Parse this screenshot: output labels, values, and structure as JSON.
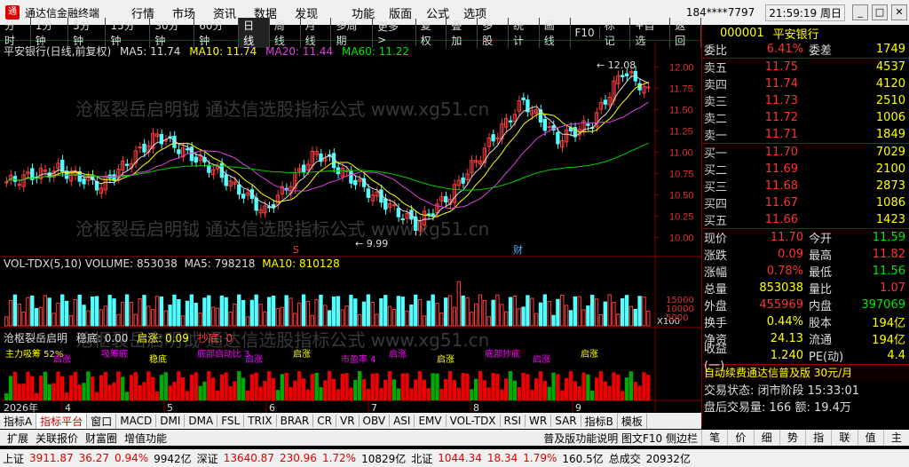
{
  "app": {
    "title": "通达信金融终端",
    "account": "184****7797",
    "clock": "21:59:19 周日"
  },
  "menu": [
    "行情",
    "市场",
    "资讯",
    "数据",
    "发现"
  ],
  "menu2": [
    "功能",
    "版面",
    "公式",
    "选项"
  ],
  "toolbar": [
    "分时",
    "1分钟",
    "5分钟",
    "15分钟",
    "30分钟",
    "60分钟",
    "日线",
    "周线",
    "月线",
    "多周期",
    "更多 >",
    "复权",
    "叠加",
    "多股",
    "统计",
    "画线",
    "F10",
    "标记",
    "+自选",
    "返回"
  ],
  "toolbar_active": "日线",
  "main_legend": {
    "prefix": "平安银行(日线,前复权)",
    "ma5": "MA5: 11.74",
    "ma10": "MA10: 11.74",
    "ma20": "MA20: 11.44",
    "ma60": "MA60: 11.22"
  },
  "vol_legend": {
    "label": "VOL-TDX(5,10) VOLUME: 853038",
    "ma5": "MA5: 798218",
    "ma10": "MA10: 810128"
  },
  "ind_legend": {
    "label": "沧枢裂岳启明",
    "stable": "稳底: 0.00",
    "start": "启涨: 0.09",
    "bottom": "抄底: 0"
  },
  "chart_labels": {
    "high": "12.08",
    "low": "9.99",
    "s_mark": "S",
    "cai_mark": "财",
    "vol_axis": "X100",
    "date_year": "2026年",
    "months": [
      "4",
      "5",
      "6",
      "7",
      "8",
      "9"
    ]
  },
  "price_axis": [
    "12.00",
    "11.75",
    "11.50",
    "11.25",
    "11.00",
    "10.75",
    "10.50",
    "10.25",
    "10.00"
  ],
  "vol_axis_ticks": [
    "15000",
    "10000",
    "5000"
  ],
  "ind_annotations": [
    "主力吸筹 52%",
    "启涨",
    "吸筹底",
    "稳底",
    "底部启动比 3",
    "启涨",
    "启涨",
    "市盈率 4",
    "启涨",
    "启涨",
    "底部抄底",
    "启涨",
    "启涨"
  ],
  "watermark": "沧枢裂岳启明钺 通达信选股指标公式 www.xg51.cn",
  "quote": {
    "code": "000001",
    "name": "平安银行",
    "ratio_label": "委比",
    "ratio": "6.41%",
    "diff_label": "委差",
    "diff": "1749",
    "asks": [
      {
        "label": "卖五",
        "price": "11.75",
        "vol": "4537"
      },
      {
        "label": "卖四",
        "price": "11.74",
        "vol": "4120"
      },
      {
        "label": "卖三",
        "price": "11.73",
        "vol": "2510"
      },
      {
        "label": "卖二",
        "price": "11.72",
        "vol": "1006"
      },
      {
        "label": "卖一",
        "price": "11.71",
        "vol": "1849"
      }
    ],
    "bids": [
      {
        "label": "买一",
        "price": "11.70",
        "vol": "7029"
      },
      {
        "label": "买二",
        "price": "11.69",
        "vol": "2100"
      },
      {
        "label": "买三",
        "price": "11.68",
        "vol": "2873"
      },
      {
        "label": "买四",
        "price": "11.67",
        "vol": "1086"
      },
      {
        "label": "买五",
        "price": "11.66",
        "vol": "1423"
      }
    ],
    "stats": [
      {
        "l1": "现价",
        "v1": "11.70",
        "c1": "red",
        "l2": "今开",
        "v2": "11.59",
        "c2": "grn"
      },
      {
        "l1": "涨跌",
        "v1": "0.09",
        "c1": "red",
        "l2": "最高",
        "v2": "11.82",
        "c2": "red"
      },
      {
        "l1": "涨幅",
        "v1": "0.78%",
        "c1": "red",
        "l2": "最低",
        "v2": "11.56",
        "c2": "grn"
      },
      {
        "l1": "总量",
        "v1": "853038",
        "c1": "yel",
        "l2": "量比",
        "v2": "1.07",
        "c2": "red"
      },
      {
        "l1": "外盘",
        "v1": "455969",
        "c1": "red",
        "l2": "内盘",
        "v2": "397069",
        "c2": "grn"
      },
      {
        "l1": "换手",
        "v1": "0.44%",
        "c1": "yel",
        "l2": "股本",
        "v2": "194亿",
        "c2": "yel"
      },
      {
        "l1": "净资",
        "v1": "24.13",
        "c1": "yel",
        "l2": "流通",
        "v2": "194亿",
        "c2": "yel"
      },
      {
        "l1": "收益(一)",
        "v1": "1.240",
        "c1": "yel",
        "l2": "PE(动)",
        "v2": "4.4",
        "c2": "yel"
      }
    ],
    "ad": "自动续费通达信普及版 30元/月",
    "trade_state": "交易状态: 闭市阶段  15:33:01",
    "last_deal": "盘后交易量: 166  额: 19.4万"
  },
  "bottom_tabs": [
    "指标A",
    "指标平台",
    "窗口",
    "MACD",
    "DMI",
    "DMA",
    "FSL",
    "TRIX",
    "BRAR",
    "CR",
    "VR",
    "OBV",
    "ASI",
    "EMV",
    "VOL-TDX",
    "RSI",
    "WR",
    "SAR",
    "指标B",
    "模板"
  ],
  "bottom_tabs_active": "指标平台",
  "bottom_tabs2": [
    "扩展",
    "关联报价",
    "财富圈",
    "增值功能"
  ],
  "bottom_tabs2_right": "普及版功能说明  图文F10 侧边栏",
  "trade_tabs": [
    "笔",
    "价",
    "细",
    "势",
    "指",
    "联",
    "值",
    "主"
  ],
  "status": [
    {
      "t": "上证",
      "c": "blk"
    },
    {
      "t": "3911.87",
      "c": "red"
    },
    {
      "t": "36.27",
      "c": "red"
    },
    {
      "t": "0.94%",
      "c": "red"
    },
    {
      "t": "9942亿",
      "c": "blk"
    },
    {
      "t": "深证",
      "c": "blk"
    },
    {
      "t": "13640.87",
      "c": "red"
    },
    {
      "t": "230.96",
      "c": "red"
    },
    {
      "t": "1.72%",
      "c": "red"
    },
    {
      "t": "10829亿",
      "c": "blk"
    },
    {
      "t": "北证",
      "c": "blk"
    },
    {
      "t": "1044.34",
      "c": "red"
    },
    {
      "t": "18.34",
      "c": "red"
    },
    {
      "t": "1.79%",
      "c": "red"
    },
    {
      "t": "160.5亿",
      "c": "blk"
    },
    {
      "t": "总成交",
      "c": "blk"
    },
    {
      "t": "20932亿",
      "c": "blk"
    }
  ]
}
